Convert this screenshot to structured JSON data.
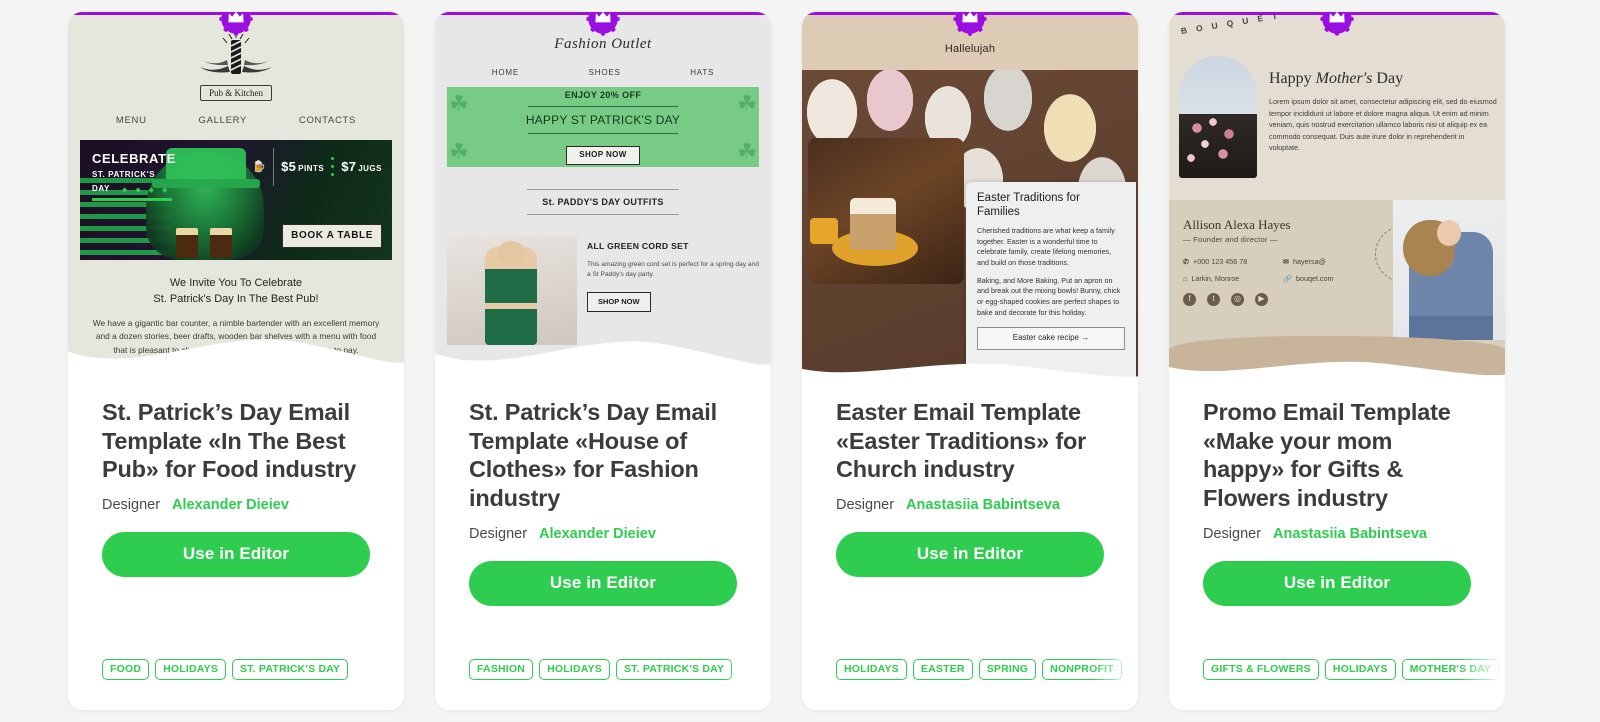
{
  "page": {
    "background_color": "#f4f4f4",
    "accent_green": "#2ecc4f",
    "badge_purple": "#9b0ee0"
  },
  "cards": [
    {
      "badge_icon": "crown-icon",
      "title": "St. Patrick’s Day Email Template «In The Best Pub» for Food industry",
      "designer_label": "Designer",
      "designer_name": "Alexander Dieiev",
      "cta_label": "Use in Editor",
      "tags": [
        "FOOD",
        "HOLIDAYS",
        "ST. PATRICK'S DAY"
      ],
      "preview": {
        "logo_name": "Pub & Kitchen",
        "nav": [
          "MENU",
          "GALLERY",
          "CONTACTS"
        ],
        "hero_title": "CELEBRATE",
        "hero_sub1": "ST. PATRICK'S",
        "hero_sub2": "DAY",
        "hero_dots": "◆ ◆ ◆ ◆",
        "price_left_amount": "$5",
        "price_left_unit": "PINTS",
        "price_right_amount": "$7",
        "price_right_unit": "JUGS",
        "hero_button": "BOOK A TABLE",
        "invite_line1": "We Invite You To Celebrate",
        "invite_line2": "St. Patrick's Day In The Best Pub!",
        "body_text": "We have a gigantic bar counter, a nimble bartender with an excellent memory and a dozen stories, beer drafts, wooden bar shelves with a menu with food that is pleasant to choose, is a which it is quite inexpensive to pay."
      }
    },
    {
      "badge_icon": "crown-icon",
      "title": "St. Patrick’s Day Email Template «House of Clothes» for Fashion industry",
      "designer_label": "Designer",
      "designer_name": "Alexander Dieiev",
      "cta_label": "Use in Editor",
      "tags": [
        "FASHION",
        "HOLIDAYS",
        "ST. PATRICK'S DAY"
      ],
      "preview": {
        "brand": "Fashion Outlet",
        "nav": [
          "HOME",
          "SHOES",
          "HATS"
        ],
        "banner_offer": "ENJOY 20% OFF",
        "banner_main": "HAPPY ST PATRICK'S DAY",
        "banner_button": "SHOP NOW",
        "section_title": "St. PADDY'S DAY OUTFITS",
        "product_title": "ALL GREEN CORD SET",
        "product_desc": "This amazing green cord set is perfect for a spring day and a St Paddy's day party.",
        "product_button": "SHOP NOW"
      }
    },
    {
      "badge_icon": "crown-icon",
      "title": "Easter Email Template «Easter Traditions» for Church industry",
      "designer_label": "Designer",
      "designer_name": "Anastasiia Babintseva",
      "cta_label": "Use in Editor",
      "tags": [
        "HOLIDAYS",
        "EASTER",
        "SPRING",
        "NONPROFIT"
      ],
      "preview": {
        "brand": "Hallelujah",
        "panel_title": "Easter Traditions for Families",
        "panel_para1": "Cherished traditions are what keep a family together. Easter is a wonderful time to celebrate family, create lifelong memories, and build on those traditions.",
        "panel_para2": "Baking, and More Baking. Put an apron on and break out the mixing bowls! Bunny, chick or egg-shaped cookies are perfect shapes to bake and decorate for this holiday.",
        "panel_button": "Easter cake recipe  →"
      }
    },
    {
      "badge_icon": "crown-icon",
      "title": "Promo Email Template «Make your mom happy» for Gifts & Flowers industry",
      "designer_label": "Designer",
      "designer_name": "Anastasiia Babintseva",
      "cta_label": "Use in Editor",
      "tags": [
        "GIFTS & FLOWERS",
        "HOLIDAYS",
        "MOTHER'S DAY"
      ],
      "preview": {
        "brand": "B O U Q U E T",
        "headline_prefix": "Happy ",
        "headline_italic": "Mother's",
        "headline_suffix": " Day",
        "lorem": "Lorem ipsum dolor sit amet, consectetur adipiscing elit, sed do eiusmod tempor incididunt ut labore et dolore magna aliqua. Ut enim ad minim veniam, quis nostrud exercitation ullamco laboris nisi ut aliquip ex ea commodo consequat. Duis aute irure dolor in reprehenderit in voluptate.",
        "signature_name": "Allison Alexa Hayes",
        "signature_role": "— Founder and director —",
        "contact_phone": "+000 123 456 78",
        "contact_email": "hayersa@",
        "contact_address": "Larkin, Monroe",
        "contact_site": "bouqet.com",
        "socials": [
          "facebook-icon",
          "tumblr-icon",
          "instagram-icon",
          "youtube-icon"
        ]
      }
    }
  ]
}
